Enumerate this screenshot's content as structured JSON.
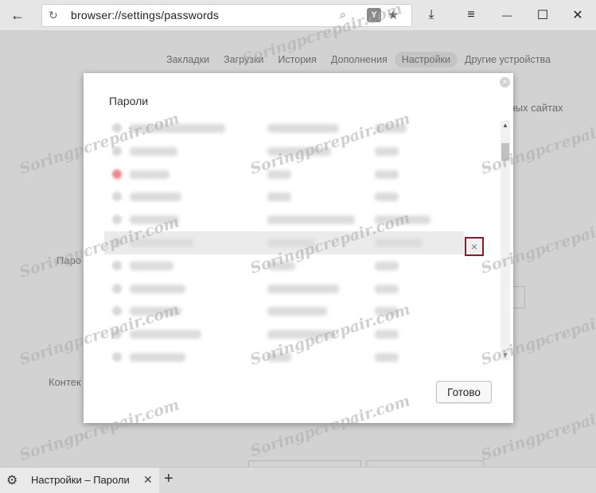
{
  "browser": {
    "url": "browser://settings/passwords",
    "back_glyph": "←",
    "reload_glyph": "↻",
    "search_glyph": "⌕",
    "ybadge": "Y",
    "star_glyph": "★",
    "download_glyph": "⤓",
    "menu_glyph": "≡",
    "minimize_glyph": "—",
    "maximize_glyph": "☐",
    "close_glyph": "✕"
  },
  "settings_nav": {
    "items": [
      "Закладки",
      "Загрузки",
      "История",
      "Дополнения",
      "Настройки",
      "Другие устройства"
    ],
    "active": "Настройки"
  },
  "background_text": {
    "right_fragment": "сных сайтах",
    "left_fragment_1": "Паро",
    "left_fragment_2": "Контек"
  },
  "dialog": {
    "title": "Пароли",
    "close_glyph": "×",
    "row_delete_glyph": "×",
    "done_label": "Готово",
    "scroll_up_glyph": "▲",
    "scroll_down_glyph": "▼",
    "rows_count_visible": 11,
    "hovered_row_index": 5
  },
  "tabbar": {
    "gear_glyph": "⚙",
    "tab_title": "Настройки – Пароли",
    "tab_close_glyph": "✕",
    "new_tab_glyph": "+"
  },
  "watermark": "Soringpcrepair.com",
  "colors": {
    "delete_highlight": "#8b1a2b",
    "overlay": "rgba(170,170,170,0.45)"
  }
}
